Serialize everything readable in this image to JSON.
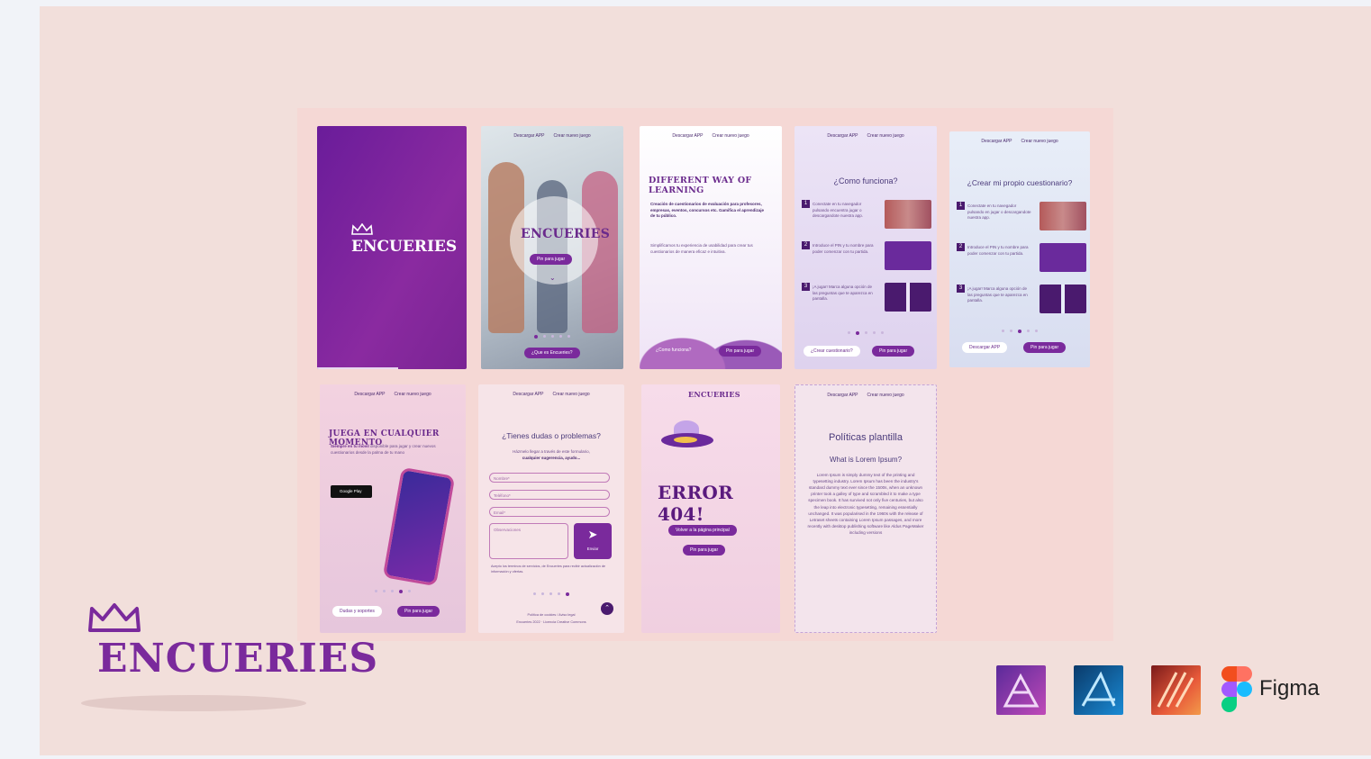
{
  "colors": {
    "accent": "#7a2a9c",
    "brand_dark": "#4a1a6e",
    "canvas": "#f2dfdb",
    "board": "#f5d8d5"
  },
  "brand": {
    "name": "ENCUERIES"
  },
  "nav": {
    "download": "Descargar APP",
    "create": "Crear nuevo juego"
  },
  "s2": {
    "play_button": "Pin para jugar",
    "what_button": "¿Que es Encueries?"
  },
  "s3": {
    "title": "DIFFERENT WAY OF LEARNING",
    "p1": "Creación de cuestionarios de evaluación para profesores, empresas, eventos, concursos etc. Gamifica el aprendizaje de tu público.",
    "p2": "Simplificamos tu experiencia de usabilidad para crear tus cuestionarios de manera eficaz e intuitiva.",
    "how_link": "¿Como funciona?",
    "play_button": "Pin para jugar"
  },
  "s4": {
    "title": "¿Como funciona?",
    "steps": [
      "Conectate en tu navegador pulsando encuentra jugar o descargandote nuestra app.",
      "Introduce el PIN y tu nombre para poder comenzar con tu partida.",
      "¡A jugar! Marca alguna opción de las preguntas que te aparezca en pantalla."
    ],
    "create_button": "¿Crear cuestionario?",
    "play_button": "Pin para jugar"
  },
  "s5": {
    "title": "¿Crear mi propio cuestionario?",
    "steps": [
      "Conectate en tu navegador pulsando en jugar o descargandote nuestra app.",
      "Introduce el PIN y tu nombre para poder comenzar con tu partida.",
      "¡A jugar! Marca alguna opción de las preguntas que te aparezca en pantalla."
    ],
    "download_button": "Descargar APP",
    "play_button": "Pin para jugar"
  },
  "s6": {
    "title": "JUEGA EN CUALQUIER MOMENTO",
    "body_bold": "Siempre en tu movil",
    "body": "disponible para jugar y crear nuevos cuestionarios desde la palma de tu mano",
    "store_badge": "Google Play",
    "help_button": "Dudas y soportes",
    "play_button": "Pin para jugar"
  },
  "s7": {
    "title": "¿Tienes dudas o problemas?",
    "intro": "Házmelo llegar a través de este formulario,",
    "intro_bold": "cualquier sugerencia, ayudo...",
    "fields": [
      "Nombre*",
      "Teléfono*",
      "Email*"
    ],
    "message_placeholder": "Observaciones",
    "send_button": "Enviar",
    "terms": "Acepto los terminos de servicios, de Encueries para recibir actualización de información y ofertas.",
    "footer_links": "Política de cookies / Aviso legal",
    "footer_copy": "Encueries 2022 · Licencia Creative Commons"
  },
  "s8": {
    "error_text": "ERROR 404!",
    "home_button": "Volver a la página principal",
    "play_button": "Pin para jugar"
  },
  "s9": {
    "title": "Políticas plantilla",
    "subtitle": "What is Lorem Ipsum?",
    "body": "Lorem Ipsum is simply dummy text of the printing and typesetting industry. Lorem Ipsum has been the industry's standard dummy text ever since the 1500s, when an unknown printer took a galley of type and scrambled it to make a type specimen book. It has survived not only five centuries, but also the leap into electronic typesetting, remaining essentially unchanged. It was popularised in the 1960s with the release of Letraset sheets containing Lorem Ipsum passages, and more recently with desktop publishing software like Aldus PageMaker including versions"
  },
  "tools": {
    "figma_label": "Figma",
    "icons": [
      "affinity-photo-icon",
      "affinity-designer-icon",
      "affinity-publisher-icon",
      "figma-icon"
    ]
  }
}
